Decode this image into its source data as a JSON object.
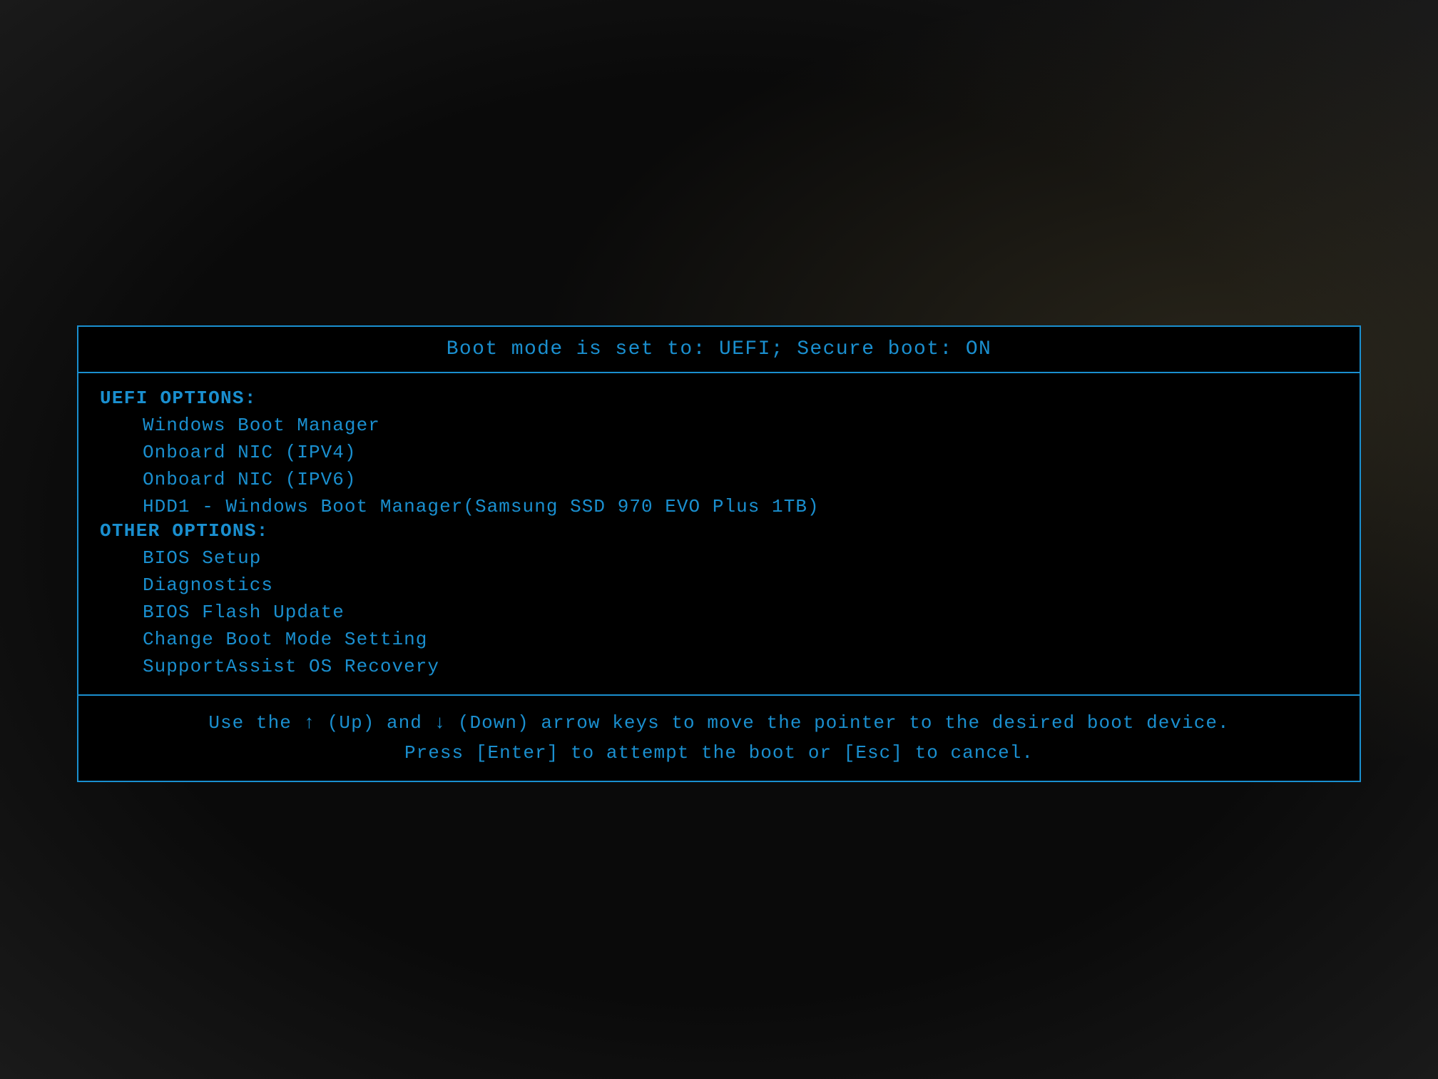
{
  "header": {
    "title": "Boot mode is set to: UEFI; Secure boot: ON"
  },
  "uefi_section": {
    "label": "UEFI OPTIONS:",
    "items": [
      {
        "text": "Windows Boot Manager"
      },
      {
        "text": "Onboard NIC (IPV4)"
      },
      {
        "text": "Onboard NIC (IPV6)"
      },
      {
        "text": "HDD1 - Windows Boot Manager(Samsung SSD 970 EVO Plus 1TB)"
      }
    ]
  },
  "other_section": {
    "label": "OTHER OPTIONS:",
    "items": [
      {
        "text": "BIOS Setup"
      },
      {
        "text": "Diagnostics"
      },
      {
        "text": "BIOS Flash Update"
      },
      {
        "text": "Change Boot Mode Setting"
      },
      {
        "text": "SupportAssist OS Recovery"
      }
    ]
  },
  "footer": {
    "line1": "Use the ↑ (Up) and ↓ (Down) arrow keys to move the pointer to the desired boot device.",
    "line2": "Press [Enter] to attempt the boot or [Esc] to cancel."
  }
}
